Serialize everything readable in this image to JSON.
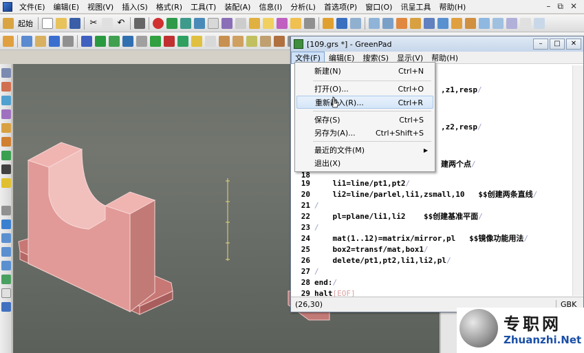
{
  "app": {
    "menu": [
      "文件(E)",
      "编辑(E)",
      "视图(V)",
      "插入(S)",
      "格式(R)",
      "工具(T)",
      "装配(A)",
      "信息(I)",
      "分析(L)",
      "首选项(P)",
      "窗口(O)",
      "讯呈工具",
      "帮助(H)"
    ],
    "toolbar_start_label": "起始"
  },
  "greenpad": {
    "title": "[109.grs *] - GreenPad",
    "menu": [
      "文件(F)",
      "编辑(E)",
      "搜索(S)",
      "显示(V)",
      "帮助(H)"
    ],
    "status_position": "(26,30)",
    "status_encoding": "GBK",
    "visible_fragments": [
      {
        "id": "f1",
        "text": ",z1,resp"
      },
      {
        "id": "f2",
        "text": ",z2,resp"
      },
      {
        "id": "f3",
        "text": "建两个点"
      }
    ],
    "lines": [
      {
        "n": "18",
        "text": ""
      },
      {
        "n": "19",
        "text": "    li1=line/pt1,pt2"
      },
      {
        "n": "20",
        "text": "    li2=line/parlel,li1,zsmall,10   $$创建两条直线"
      },
      {
        "n": "21",
        "text": ""
      },
      {
        "n": "22",
        "text": "    pl=plane/li1,li2    $$创建基准平面"
      },
      {
        "n": "23",
        "text": ""
      },
      {
        "n": "24",
        "text": "    mat(1..12)=matrix/mirror,pl   $$镜像功能用法"
      },
      {
        "n": "25",
        "text": "    box2=transf/mat,box1"
      },
      {
        "n": "26",
        "text": "    delete/pt1,pt2,li1,li2,pl"
      },
      {
        "n": "27",
        "text": ""
      },
      {
        "n": "28",
        "text": "end:"
      },
      {
        "n": "29",
        "text": "halt"
      }
    ],
    "eof_marker": "[EOF]"
  },
  "file_menu": {
    "items": [
      {
        "label": "新建(N)",
        "shortcut": "Ctrl+N"
      },
      {
        "label": "打开(O)...",
        "shortcut": "Ctrl+O"
      },
      {
        "label": "重新载入(R)...",
        "shortcut": "Ctrl+R"
      },
      {
        "label": "保存(S)",
        "shortcut": "Ctrl+S"
      },
      {
        "label": "另存为(A)...",
        "shortcut": "Ctrl+Shift+S"
      },
      {
        "label": "最近的文件(M)",
        "shortcut": ""
      },
      {
        "label": "退出(X)",
        "shortcut": ""
      }
    ],
    "highlighted_index": 2
  },
  "watermark": {
    "cn": "专职网",
    "en": "Zhuanzhi.Net"
  },
  "colors": {
    "part_face": "#e7a3a0",
    "part_side": "#c97d7a",
    "viewport_bg": "#626760",
    "menu_highlight": "#d5e6f8",
    "watermark_link": "#1a4fa8"
  }
}
